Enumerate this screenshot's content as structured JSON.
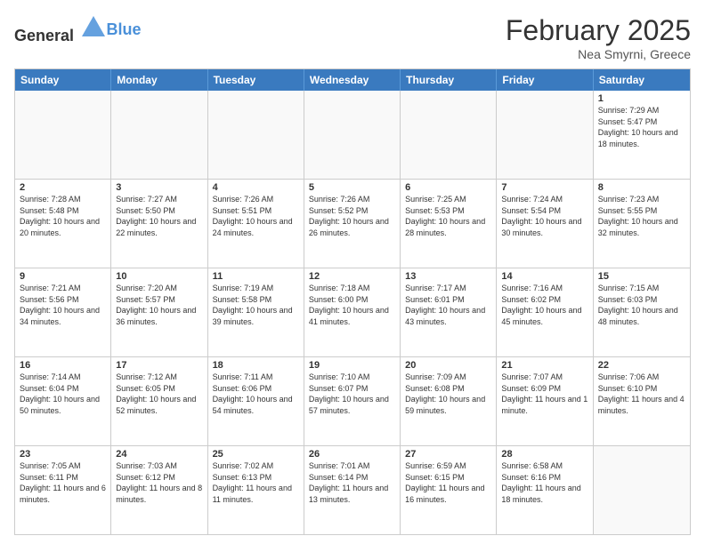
{
  "header": {
    "logo_general": "General",
    "logo_blue": "Blue",
    "month_title": "February 2025",
    "location": "Nea Smyrni, Greece"
  },
  "weekdays": [
    "Sunday",
    "Monday",
    "Tuesday",
    "Wednesday",
    "Thursday",
    "Friday",
    "Saturday"
  ],
  "weeks": [
    [
      {
        "day": "",
        "empty": true
      },
      {
        "day": "",
        "empty": true
      },
      {
        "day": "",
        "empty": true
      },
      {
        "day": "",
        "empty": true
      },
      {
        "day": "",
        "empty": true
      },
      {
        "day": "",
        "empty": true
      },
      {
        "day": "1",
        "sunrise": "Sunrise: 7:29 AM",
        "sunset": "Sunset: 5:47 PM",
        "daylight": "Daylight: 10 hours and 18 minutes."
      }
    ],
    [
      {
        "day": "2",
        "sunrise": "Sunrise: 7:28 AM",
        "sunset": "Sunset: 5:48 PM",
        "daylight": "Daylight: 10 hours and 20 minutes."
      },
      {
        "day": "3",
        "sunrise": "Sunrise: 7:27 AM",
        "sunset": "Sunset: 5:50 PM",
        "daylight": "Daylight: 10 hours and 22 minutes."
      },
      {
        "day": "4",
        "sunrise": "Sunrise: 7:26 AM",
        "sunset": "Sunset: 5:51 PM",
        "daylight": "Daylight: 10 hours and 24 minutes."
      },
      {
        "day": "5",
        "sunrise": "Sunrise: 7:26 AM",
        "sunset": "Sunset: 5:52 PM",
        "daylight": "Daylight: 10 hours and 26 minutes."
      },
      {
        "day": "6",
        "sunrise": "Sunrise: 7:25 AM",
        "sunset": "Sunset: 5:53 PM",
        "daylight": "Daylight: 10 hours and 28 minutes."
      },
      {
        "day": "7",
        "sunrise": "Sunrise: 7:24 AM",
        "sunset": "Sunset: 5:54 PM",
        "daylight": "Daylight: 10 hours and 30 minutes."
      },
      {
        "day": "8",
        "sunrise": "Sunrise: 7:23 AM",
        "sunset": "Sunset: 5:55 PM",
        "daylight": "Daylight: 10 hours and 32 minutes."
      }
    ],
    [
      {
        "day": "9",
        "sunrise": "Sunrise: 7:21 AM",
        "sunset": "Sunset: 5:56 PM",
        "daylight": "Daylight: 10 hours and 34 minutes."
      },
      {
        "day": "10",
        "sunrise": "Sunrise: 7:20 AM",
        "sunset": "Sunset: 5:57 PM",
        "daylight": "Daylight: 10 hours and 36 minutes."
      },
      {
        "day": "11",
        "sunrise": "Sunrise: 7:19 AM",
        "sunset": "Sunset: 5:58 PM",
        "daylight": "Daylight: 10 hours and 39 minutes."
      },
      {
        "day": "12",
        "sunrise": "Sunrise: 7:18 AM",
        "sunset": "Sunset: 6:00 PM",
        "daylight": "Daylight: 10 hours and 41 minutes."
      },
      {
        "day": "13",
        "sunrise": "Sunrise: 7:17 AM",
        "sunset": "Sunset: 6:01 PM",
        "daylight": "Daylight: 10 hours and 43 minutes."
      },
      {
        "day": "14",
        "sunrise": "Sunrise: 7:16 AM",
        "sunset": "Sunset: 6:02 PM",
        "daylight": "Daylight: 10 hours and 45 minutes."
      },
      {
        "day": "15",
        "sunrise": "Sunrise: 7:15 AM",
        "sunset": "Sunset: 6:03 PM",
        "daylight": "Daylight: 10 hours and 48 minutes."
      }
    ],
    [
      {
        "day": "16",
        "sunrise": "Sunrise: 7:14 AM",
        "sunset": "Sunset: 6:04 PM",
        "daylight": "Daylight: 10 hours and 50 minutes."
      },
      {
        "day": "17",
        "sunrise": "Sunrise: 7:12 AM",
        "sunset": "Sunset: 6:05 PM",
        "daylight": "Daylight: 10 hours and 52 minutes."
      },
      {
        "day": "18",
        "sunrise": "Sunrise: 7:11 AM",
        "sunset": "Sunset: 6:06 PM",
        "daylight": "Daylight: 10 hours and 54 minutes."
      },
      {
        "day": "19",
        "sunrise": "Sunrise: 7:10 AM",
        "sunset": "Sunset: 6:07 PM",
        "daylight": "Daylight: 10 hours and 57 minutes."
      },
      {
        "day": "20",
        "sunrise": "Sunrise: 7:09 AM",
        "sunset": "Sunset: 6:08 PM",
        "daylight": "Daylight: 10 hours and 59 minutes."
      },
      {
        "day": "21",
        "sunrise": "Sunrise: 7:07 AM",
        "sunset": "Sunset: 6:09 PM",
        "daylight": "Daylight: 11 hours and 1 minute."
      },
      {
        "day": "22",
        "sunrise": "Sunrise: 7:06 AM",
        "sunset": "Sunset: 6:10 PM",
        "daylight": "Daylight: 11 hours and 4 minutes."
      }
    ],
    [
      {
        "day": "23",
        "sunrise": "Sunrise: 7:05 AM",
        "sunset": "Sunset: 6:11 PM",
        "daylight": "Daylight: 11 hours and 6 minutes."
      },
      {
        "day": "24",
        "sunrise": "Sunrise: 7:03 AM",
        "sunset": "Sunset: 6:12 PM",
        "daylight": "Daylight: 11 hours and 8 minutes."
      },
      {
        "day": "25",
        "sunrise": "Sunrise: 7:02 AM",
        "sunset": "Sunset: 6:13 PM",
        "daylight": "Daylight: 11 hours and 11 minutes."
      },
      {
        "day": "26",
        "sunrise": "Sunrise: 7:01 AM",
        "sunset": "Sunset: 6:14 PM",
        "daylight": "Daylight: 11 hours and 13 minutes."
      },
      {
        "day": "27",
        "sunrise": "Sunrise: 6:59 AM",
        "sunset": "Sunset: 6:15 PM",
        "daylight": "Daylight: 11 hours and 16 minutes."
      },
      {
        "day": "28",
        "sunrise": "Sunrise: 6:58 AM",
        "sunset": "Sunset: 6:16 PM",
        "daylight": "Daylight: 11 hours and 18 minutes."
      },
      {
        "day": "",
        "empty": true
      }
    ]
  ]
}
